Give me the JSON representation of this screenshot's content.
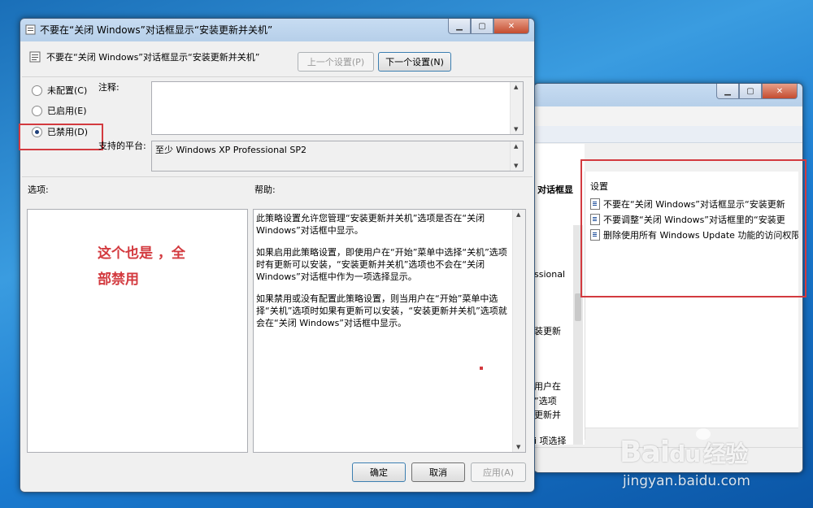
{
  "back_window": {
    "column_header_partial": "对话框显",
    "settings_header": "设置",
    "settings_items": [
      "不要在“关闭 Windows”对话框显示“安装更新",
      "不要调整“关闭 Windows”对话框里的“安装更",
      "删除使用所有 Windows Update 功能的访问权限"
    ],
    "fragments": [
      "ssional",
      "装更新",
      "用户在",
      "”选项",
      "更新并",
      "i 项选择"
    ]
  },
  "dialog": {
    "title": "不要在“关闭 Windows”对话框显示“安装更新并关机”",
    "header_setting_name": "不要在“关闭 Windows”对话框显示“安装更新并关机”",
    "prev_button": "上一个设置(P)",
    "next_button": "下一个设置(N)",
    "radio": {
      "not_configured": "未配置(C)",
      "enabled": "已启用(E)",
      "disabled": "已禁用(D)",
      "selected": "disabled"
    },
    "comment_label": "注释:",
    "platform_label": "支持的平台:",
    "platform_value": "至少 Windows XP Professional SP2",
    "options_label": "选项:",
    "help_label": "帮助:",
    "help_paragraphs": [
      "此策略设置允许您管理“安装更新并关机”选项是否在“关闭 Windows”对话框中显示。",
      "如果启用此策略设置，即使用户在“开始”菜单中选择“关机”选项时有更新可以安装，“安装更新并关机”选项也不会在“关闭 Windows”对话框中作为一项选择显示。",
      "如果禁用或没有配置此策略设置，则当用户在“开始”菜单中选择“关机”选项时如果有更新可以安装，“安装更新并关机”选项就会在“关闭 Windows”对话框中显示。"
    ],
    "ok_button": "确定",
    "cancel_button": "取消",
    "apply_button": "应用(A)"
  },
  "annotation": {
    "line1": "这个也是 ，全",
    "line2": "部禁用",
    "color": "#d33a3f"
  },
  "watermark": {
    "logo_text": "Bai",
    "logo_suffix": "经验",
    "url": "jingyan.baidu.com"
  },
  "colors": {
    "highlight_red": "#d33a3f",
    "desktop_blue": "#1b7bd0"
  }
}
